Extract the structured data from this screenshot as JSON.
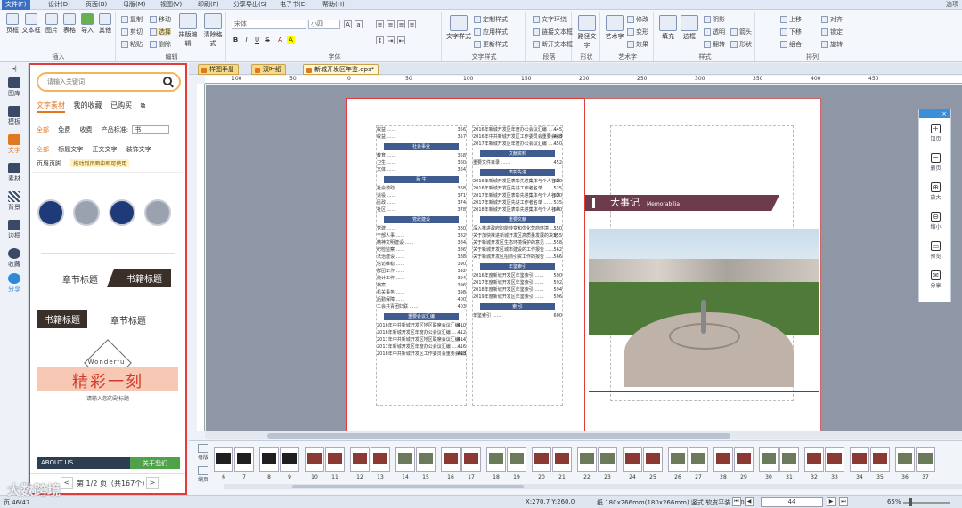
{
  "menu": {
    "items": [
      "文件(F)",
      "设计(D)",
      "页面(B)",
      "母版(M)",
      "视图(V)",
      "印刷(P)",
      "分享导出(S)",
      "电子书(E)",
      "帮助(H)"
    ],
    "right": "选项"
  },
  "ribbon": {
    "insert": {
      "label": "插入",
      "buttons": [
        "页框",
        "文本框",
        "图片",
        "表格",
        "导入",
        "其他"
      ]
    },
    "edit": {
      "label": "编辑",
      "small": [
        "复制",
        "剪切",
        "粘贴",
        "移动",
        "选择",
        "删除"
      ],
      "big": [
        "排版编辑",
        "清除格式"
      ]
    },
    "font": {
      "label": "字体",
      "font_name": "宋体",
      "font_size": "小四",
      "buttons": [
        "B",
        "I",
        "U",
        "S",
        "A",
        "A"
      ]
    },
    "text_style": {
      "label": "文字样式",
      "big": "文字样式",
      "small": [
        "定制样式",
        "应用样式",
        "更新样式",
        "新建样式"
      ]
    },
    "paragraph": {
      "label": "段落",
      "small": [
        "文字环绕",
        "链接文本框",
        "断开文本框"
      ]
    },
    "shape": {
      "label": "形状",
      "big": "路径文字"
    },
    "art": {
      "label": "艺术字",
      "big": "艺术字",
      "small": [
        "修改",
        "变形",
        "效果"
      ]
    },
    "style": {
      "label": "样式",
      "big": [
        "填充",
        "边框"
      ],
      "small": [
        "阴影",
        "透明",
        "翻转",
        "箭头",
        "形状"
      ]
    },
    "arrange": {
      "label": "排列",
      "small": [
        "上移",
        "下移",
        "组合",
        "取消组合",
        "对齐",
        "锁定",
        "旋转"
      ]
    }
  },
  "rail": {
    "items": [
      "图库",
      "模板",
      "文字",
      "素材",
      "背景",
      "边框",
      "收藏",
      "分享"
    ],
    "selected": "文字"
  },
  "panel": {
    "search_placeholder": "请输入关键词",
    "tabs": [
      "文字素材",
      "我的收藏",
      "已购买"
    ],
    "filter1": [
      "全部",
      "免费",
      "收费",
      "产品标准:"
    ],
    "filter1_select": "书",
    "filter2": [
      "全部",
      "标题文字",
      "正文文字",
      "装饰文字"
    ],
    "filter3": "页眉页脚",
    "filter3_tip": "拖动到页面中即可使用",
    "samples": {
      "chapter_a": "章节标题",
      "chapter_b": "书籍标题",
      "chapter_c": "书籍标题",
      "chapter_d": "章节标题",
      "wonder_en": "Wonderful",
      "wonder_cn": "精彩一刻",
      "wonder_sub": "请输入您的副标题",
      "about": "ABOUT US",
      "about_right": "关于我们"
    },
    "pager": {
      "prev": "<",
      "text": "第 1/2 页（共167个）",
      "next": ">"
    }
  },
  "doc_tabs": [
    {
      "label": "样图手册"
    },
    {
      "label": "双叶纸"
    },
    {
      "label": "新城开发区年鉴.dps*",
      "active": true
    }
  ],
  "ruler": {
    "h_marks": [
      "100",
      "50",
      "0",
      "50",
      "100",
      "150",
      "200",
      "250",
      "300",
      "350",
      "400",
      "450"
    ]
  },
  "document": {
    "toc_left_top": [
      {
        "t": "收益",
        "p": "356"
      },
      {
        "t": "收益",
        "p": "357"
      }
    ],
    "toc_left_sections": [
      {
        "head": "社会事业",
        "lines": [
          [
            "教育",
            "358"
          ],
          [
            "卫生",
            "360"
          ],
          [
            "文体",
            "364"
          ]
        ]
      },
      {
        "head": "民 生",
        "lines": [
          [
            "社会救助",
            "368"
          ],
          [
            "退役",
            "371"
          ],
          [
            "民政",
            "374"
          ],
          [
            "社区",
            "378"
          ]
        ]
      },
      {
        "head": "党政建设",
        "lines": [
          [
            "党建",
            "380"
          ],
          [
            "干部人事",
            "382"
          ],
          [
            "精神文明建设",
            "384"
          ],
          [
            "纪检监察",
            "386"
          ],
          [
            "法治建设",
            "388"
          ],
          [
            "信访维稳",
            "390"
          ],
          [
            "群团工作",
            "392"
          ],
          [
            "统计工作",
            "394"
          ],
          [
            "档案",
            "396"
          ],
          [
            "机关事务",
            "398"
          ],
          [
            "后勤保障",
            "400"
          ],
          [
            "工会共青团妇联",
            "403"
          ]
        ]
      },
      {
        "head": "重要会议汇编",
        "lines": [
          [
            "2016年中共新城开发区地区联席会议汇编",
            "410"
          ],
          [
            "2016年新城开发区年度办公会议汇编",
            "412"
          ],
          [
            "2017年中共新城开发区地区联席会议汇编",
            "414"
          ],
          [
            "2017年新城开发区年度办公会议汇编",
            "416"
          ],
          [
            "2018年中共新城开发区工作委员会重要会议汇编",
            "418"
          ]
        ]
      }
    ],
    "toc_right_top": [
      {
        "t": "2016年新城开发区年度办公会议汇编",
        "p": "445"
      },
      {
        "t": "2016年中共新城开发区工作委员会重要会议汇编",
        "p": "448"
      },
      {
        "t": "2017年新城开发区年度办公会议汇编",
        "p": "450"
      }
    ],
    "toc_right_sections": [
      {
        "head": "文献资料",
        "lines": [
          [
            "重要文件目录",
            "452"
          ]
        ]
      },
      {
        "head": "表彰先进",
        "lines": [
          [
            "2016年新城开发区表彰先进集体与个人名单",
            "520"
          ],
          [
            "2016年新城开发区先进工作者名单",
            "525"
          ],
          [
            "2017年新城开发区表彰先进集体与个人名单",
            "530"
          ],
          [
            "2017年新城开发区先进工作者名单",
            "535"
          ],
          [
            "2018年新城开发区表彰先进集体与个人名单",
            "540"
          ]
        ]
      },
      {
        "head": "重要文献",
        "lines": [
          [
            "深入推进政府职能转变和优化营商环境",
            "550"
          ],
          [
            "关于加快推进新城开发区高质量发展的决定",
            "555"
          ],
          [
            "关于新城开发区生态环境保护的意见",
            "558"
          ],
          [
            "关于新城开发区城市建设的工作报告",
            "562"
          ],
          [
            "关于新城开发区招商引资工作的报告",
            "566"
          ]
        ]
      },
      {
        "head": "年鉴索引",
        "lines": [
          [
            "2016年度新城开发区年鉴索引",
            "590"
          ],
          [
            "2017年度新城开发区年鉴索引",
            "592"
          ],
          [
            "2018年度新城开发区年鉴索引",
            "594"
          ],
          [
            "2019年度新城开发区年鉴索引",
            "596"
          ]
        ]
      },
      {
        "head": "索 引",
        "lines": [
          [
            "年鉴索引",
            "600"
          ]
        ]
      }
    ],
    "banner_cn": "大事记",
    "banner_en": "Memorabilia"
  },
  "side_tools": [
    {
      "label": "加页",
      "icon": "add-page-icon",
      "glyph": "+"
    },
    {
      "label": "删页",
      "icon": "delete-page-icon",
      "glyph": "−"
    },
    {
      "label": "放大",
      "icon": "zoom-in-icon",
      "glyph": "⊕"
    },
    {
      "label": "缩小",
      "icon": "zoom-out-icon",
      "glyph": "⊖"
    },
    {
      "label": "预览",
      "icon": "preview-icon",
      "glyph": "▭"
    },
    {
      "label": "分享",
      "icon": "share-icon",
      "glyph": "✉"
    }
  ],
  "strip": {
    "side_label_top": "母版",
    "side_label_bottom": "编页",
    "spreads": [
      {
        "nums": [
          "6",
          "7"
        ],
        "kind": "dark"
      },
      {
        "nums": [
          "8",
          "9"
        ],
        "kind": "dark"
      },
      {
        "nums": [
          "10",
          "11"
        ],
        "kind": "red"
      },
      {
        "nums": [
          "12",
          "13"
        ],
        "kind": "red"
      },
      {
        "nums": [
          "14",
          "15"
        ],
        "kind": "photo"
      },
      {
        "nums": [
          "16",
          "17"
        ],
        "kind": "red"
      },
      {
        "nums": [
          "18",
          "19"
        ],
        "kind": "photo"
      },
      {
        "nums": [
          "20",
          "21"
        ],
        "kind": "red"
      },
      {
        "nums": [
          "22",
          "23"
        ],
        "kind": "photo"
      },
      {
        "nums": [
          "24",
          "25"
        ],
        "kind": "red"
      },
      {
        "nums": [
          "26",
          "27"
        ],
        "kind": "photo"
      },
      {
        "nums": [
          "28",
          "29"
        ],
        "kind": "red"
      },
      {
        "nums": [
          "30",
          "31"
        ],
        "kind": "photo"
      },
      {
        "nums": [
          "32",
          "33"
        ],
        "kind": "red"
      },
      {
        "nums": [
          "34",
          "35"
        ],
        "kind": "red"
      },
      {
        "nums": [
          "36",
          "37"
        ],
        "kind": "photo"
      }
    ]
  },
  "status": {
    "page": "页 46/47",
    "coords": "X:270.7  Y:260.0",
    "paper": "纸 180x266mm(180x266mm)  竖式  软皮平装  100页",
    "page_box": "44",
    "zoom": "65%"
  },
  "watermark": "大数跨境",
  "colors": {
    "accent": "#e07820",
    "panel_border": "#e23b3b",
    "banner": "#6d3b4c",
    "toc_head": "#3f5b8f"
  }
}
